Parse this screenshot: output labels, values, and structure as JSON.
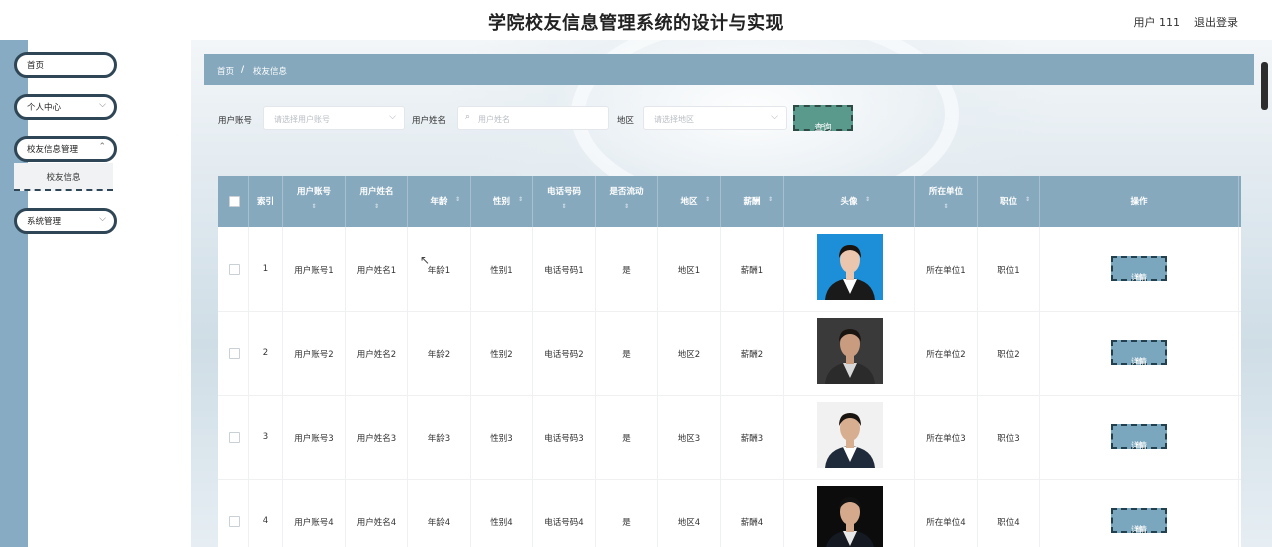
{
  "header": {
    "title": "学院校友信息管理系统的设计与实现",
    "user": "用户 111",
    "logout": "退出登录"
  },
  "sidebar": {
    "items": [
      {
        "label": "首页",
        "has_chevron": false
      },
      {
        "label": "个人中心",
        "has_chevron": true
      },
      {
        "label": "校友信息管理",
        "has_chevron": true
      },
      {
        "label": "系统管理",
        "has_chevron": true
      }
    ],
    "submenu": {
      "label": "校友信息"
    }
  },
  "breadcrumb": {
    "home": "首页",
    "sep": "/",
    "current": "校友信息"
  },
  "search": {
    "account_label": "用户账号",
    "account_placeholder": "请选择用户账号",
    "name_label": "用户姓名",
    "name_placeholder": "用户姓名",
    "region_label": "地区",
    "region_placeholder": "请选择地区",
    "query_button": "查询"
  },
  "table": {
    "headers": [
      "索引",
      "用户账号",
      "用户姓名",
      "年龄",
      "性别",
      "电话号码",
      "是否流动",
      "地区",
      "薪酬",
      "头像",
      "所在单位",
      "职位",
      "操作"
    ],
    "detail_label": "详情",
    "rows": [
      {
        "index": "1",
        "account": "用户账号1",
        "name": "用户姓名1",
        "age": "年龄1",
        "gender": "性别1",
        "phone": "电话号码1",
        "mobile": "是",
        "region": "地区1",
        "salary": "薪酬1",
        "unit": "所在单位1",
        "position": "职位1"
      },
      {
        "index": "2",
        "account": "用户账号2",
        "name": "用户姓名2",
        "age": "年龄2",
        "gender": "性别2",
        "phone": "电话号码2",
        "mobile": "是",
        "region": "地区2",
        "salary": "薪酬2",
        "unit": "所在单位2",
        "position": "职位2"
      },
      {
        "index": "3",
        "account": "用户账号3",
        "name": "用户姓名3",
        "age": "年龄3",
        "gender": "性别3",
        "phone": "电话号码3",
        "mobile": "是",
        "region": "地区3",
        "salary": "薪酬3",
        "unit": "所在单位3",
        "position": "职位3"
      },
      {
        "index": "4",
        "account": "用户账号4",
        "name": "用户姓名4",
        "age": "年龄4",
        "gender": "性别4",
        "phone": "电话号码4",
        "mobile": "是",
        "region": "地区4",
        "salary": "薪酬4",
        "unit": "所在单位4",
        "position": "职位4"
      }
    ]
  },
  "colors": {
    "accent": "#86a9be",
    "sidebar_strip": "#86abc2",
    "query_button": "#5a9a8c"
  }
}
